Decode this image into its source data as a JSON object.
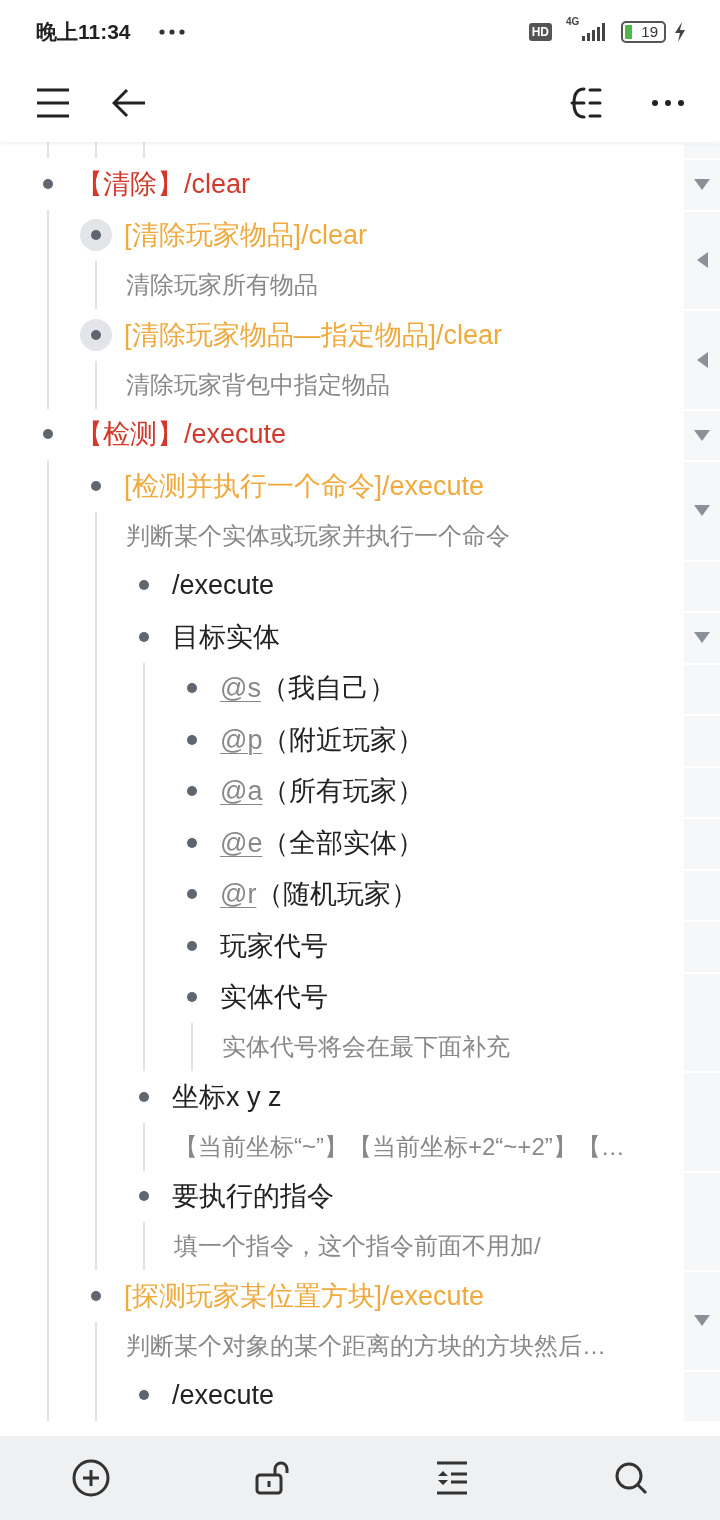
{
  "status_bar": {
    "time": "晚上11:34",
    "hd": "HD",
    "network": "4G",
    "battery": "19"
  },
  "outline": [
    {
      "kind": "category",
      "text": "【清除】/clear",
      "expanded": true,
      "children": [
        {
          "kind": "command",
          "text": "[清除玩家物品]/clear",
          "note": "清除玩家所有物品",
          "expanded": false
        },
        {
          "kind": "command",
          "text": "[清除玩家物品—指定物品]/clear",
          "note": "清除玩家背包中指定物品",
          "expanded": false
        }
      ]
    },
    {
      "kind": "category",
      "text": "【检测】/execute",
      "expanded": true,
      "children": [
        {
          "kind": "command",
          "text": "[检测并执行一个命令]/execute",
          "note": "判断某个实体或玩家并执行一个命令",
          "expanded": true,
          "children": [
            {
              "kind": "plain",
              "text": "/execute"
            },
            {
              "kind": "plain",
              "text": "目标实体",
              "expanded": true,
              "children": [
                {
                  "kind": "plain",
                  "mention": "@s",
                  "text": "（我自己）"
                },
                {
                  "kind": "plain",
                  "mention": "@p",
                  "text": "（附近玩家）"
                },
                {
                  "kind": "plain",
                  "mention": "@a",
                  "text": "（所有玩家）"
                },
                {
                  "kind": "plain",
                  "mention": "@e",
                  "text": "（全部实体）"
                },
                {
                  "kind": "plain",
                  "mention": "@r",
                  "text": "（随机玩家）"
                },
                {
                  "kind": "plain",
                  "text": "玩家代号"
                },
                {
                  "kind": "plain",
                  "text": "实体代号",
                  "note": "实体代号将会在最下面补充"
                }
              ]
            },
            {
              "kind": "plain",
              "text": "坐标x y z",
              "note": "【当前坐标“~”】【当前坐标+2“~+2”】【…"
            },
            {
              "kind": "plain",
              "text": "要执行的指令",
              "note": "填一个指令，这个指令前面不用加/"
            }
          ]
        },
        {
          "kind": "command",
          "text": "[探测玩家某位置方块]/execute",
          "note": "判断某个对象的某个距离的方块的方块然后…",
          "expanded": true,
          "children": [
            {
              "kind": "plain",
              "text": "/execute"
            }
          ]
        }
      ]
    }
  ]
}
